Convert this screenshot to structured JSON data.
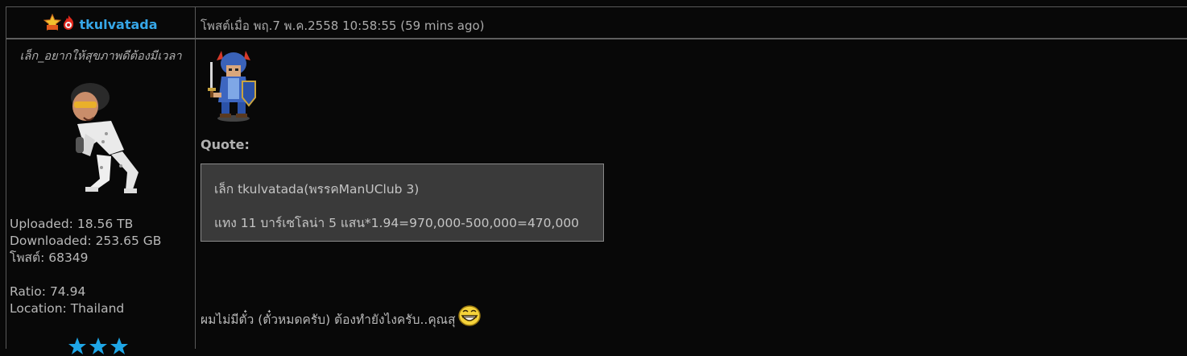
{
  "post": {
    "username": "tkulvatada",
    "posted": "โพสต์เมื่อ พฤ.7 พ.ค.2558 10:58:55 (59 mins ago)",
    "user_title": "เล็ก_อยากให้สุขภาพดีต้องมีเวลา",
    "stats": {
      "uploaded": "Uploaded: 18.56 TB",
      "downloaded": "Downloaded: 253.65 GB",
      "posts": "โพสต์: 68349",
      "ratio": "Ratio: 74.94",
      "location": "Location: Thailand"
    },
    "quote_label": "Quote:",
    "quote_lines": [
      "เล็ก tkulvatada(พรรคManUClub 3)",
      "แทง 11 บาร์เซโลน่า 5 แสน*1.94=970,000-500,000=470,000"
    ],
    "body": "ผมไม่มีตั๋ว (ตั๋วหมดครับ) ต้องทำยังไงครับ..คุณสุ"
  },
  "colors": {
    "background": "#080808",
    "username": "#36a7e8",
    "quote_bg": "#3a3a3a",
    "border": "#5a5a5a",
    "star": "#1fa6e6"
  },
  "icons": [
    "star-rank-icon",
    "fire-rank-icon",
    "sprite-knight-icon",
    "grin-smiley-icon",
    "blue-star-icon"
  ]
}
